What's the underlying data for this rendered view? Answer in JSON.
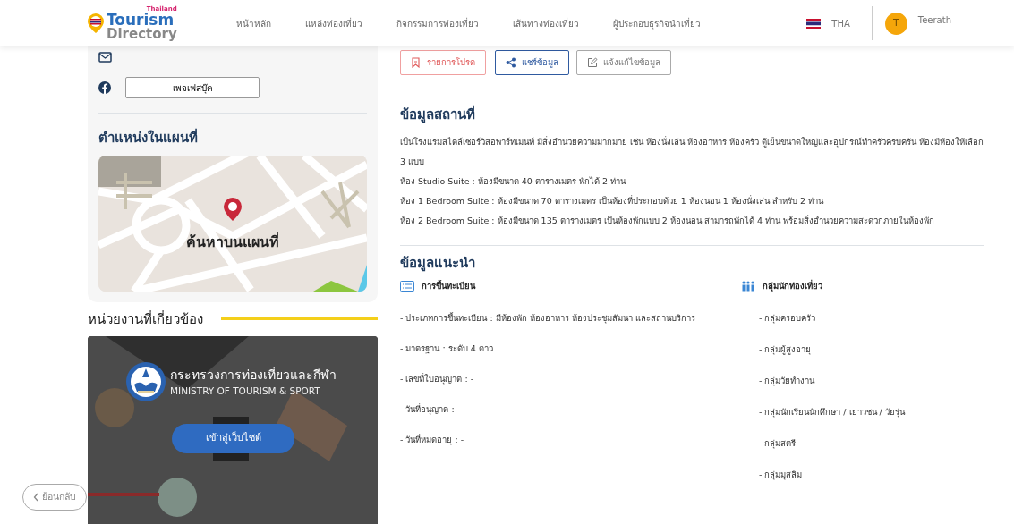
{
  "navbar": {
    "logo": {
      "country": "Thailand",
      "line1": "Tourism",
      "line2": "Directory"
    },
    "menu": [
      {
        "label": "หน้าหลัก"
      },
      {
        "label": "แหล่งท่องเที่ยว"
      },
      {
        "label": "กิจกรรมการท่องเที่ยว"
      },
      {
        "label": "เส้นทางท่องเที่ยว"
      },
      {
        "label": "ผู้ประกอบธุรกิจนำเที่ยว"
      }
    ],
    "language": "THA",
    "user": {
      "initial": "T",
      "name": "Teerath"
    }
  },
  "sidebar": {
    "facebook_button": "เพจเฟสบุ๊ค",
    "map": {
      "title": "ตำแหน่งในแผนที่",
      "label": "ค้นหาบนแผนที่"
    },
    "related": {
      "title": "หน่วยงานที่เกี่ยวข้อง",
      "card": {
        "title_th": "กระทรวงการท่องเที่ยวและกีฬา",
        "title_en": "MINISTRY OF TOURISM & SPORT",
        "button": "เข้าสู่เว็บไซต์"
      }
    }
  },
  "actions": [
    {
      "kind": "favorite",
      "label": "รายการโปรด"
    },
    {
      "kind": "share",
      "label": "แชร์ข้อมูล"
    },
    {
      "kind": "report",
      "label": "แจ้งแก้ไขข้อมูล"
    }
  ],
  "place_info": {
    "title": "ข้อมูลสถานที่",
    "paragraphs": [
      "เป็นโรงแรมสไตล์เซอร์วิสอพาร์ทเมนท์ มีสิ่งอำนวยความมากมาย เช่น ห้องนั่งเล่น ห้องอาหาร ห้องครัว ตู้เย็นขนาดใหญ่และอุปกรณ์ทำครัวครบครัน ห้องมีห้องให้เลือก 3 แบบ",
      "ห้อง Studio Suite : ห้องมีขนาด 40 ตารางเมตร พักได้ 2 ท่าน",
      "ห้อง 1 Bedroom Suite : ห้องมีขนาด 70 ตารางเมตร เป็นห้องที่ประกอบด้วย 1 ห้องนอน 1 ห้องนั่งเล่น สำหรับ 2 ท่าน",
      "ห้อง 2 Bedroom Suite : ห้องมีขนาด 135 ตารางเมตร เป็นห้องพักแบบ 2 ห้องนอน สามารถพักได้ 4 ท่าน พร้อมสิ่งอำนวยความสะดวกภายในห้องพัก"
    ]
  },
  "recommend": {
    "title": "ข้อมูลแนะนำ",
    "registration": {
      "heading": "การขึ้นทะเบียน",
      "items": [
        "- ประเภทการขึ้นทะเบียน : มีห้องพัก ห้องอาหาร ห้องประชุมสัมนา และสถานบริการ",
        "- มาตรฐาน : ระดับ 4 ดาว",
        "- เลขที่ใบอนุญาต : -",
        "- วันที่อนุญาต : -",
        "- วันที่หมดอายุ : -"
      ]
    },
    "tourist_groups": {
      "heading": "กลุ่มนักท่องเที่ยว",
      "items": [
        "- กลุ่มครอบครัว",
        "- กลุ่มผู้สูงอายุ",
        "- กลุ่มวัยทำงาน",
        "- กลุ่มนักเรียนนักศึกษา / เยาวชน / วัยรุ่น",
        "- กลุ่มสตรี",
        "- กลุ่มมุสลิม"
      ]
    }
  },
  "back_button": "ย้อนกลับ"
}
